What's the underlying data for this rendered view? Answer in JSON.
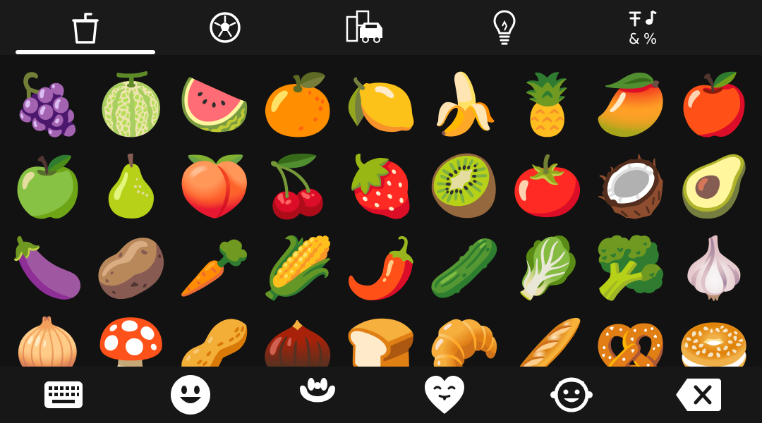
{
  "top_tabs": [
    {
      "name": "drinks-tab",
      "icon": "cup-with-straw-icon",
      "selected": true
    },
    {
      "name": "activities-tab",
      "icon": "soccer-ball-icon",
      "selected": false
    },
    {
      "name": "travel-places-tab",
      "icon": "city-car-icon",
      "selected": false
    },
    {
      "name": "objects-tab",
      "icon": "lightbulb-icon",
      "selected": false
    },
    {
      "name": "symbols-tab",
      "icon": "symbols-icon",
      "selected": false
    }
  ],
  "emoji_rows": [
    [
      "🍇",
      "🍈",
      "🍉",
      "🍊",
      "🍋",
      "🍌",
      "🍍",
      "🥭",
      "🍎"
    ],
    [
      "🍏",
      "🍐",
      "🍑",
      "🍒",
      "🍓",
      "🥝",
      "🍅",
      "🥥",
      "🥑"
    ],
    [
      "🍆",
      "🥔",
      "🥕",
      "🌽",
      "🌶️",
      "🥒",
      "🥬",
      "🥦",
      "🧄"
    ],
    [
      "🧅",
      "🍄",
      "🥜",
      "🌰",
      "🍞",
      "🥐",
      "🥖",
      "🥨",
      "🥯"
    ]
  ],
  "bottom_bar": [
    {
      "name": "keyboard-button",
      "icon": "keyboard-icon"
    },
    {
      "name": "emoji-button",
      "icon": "smiley-icon"
    },
    {
      "name": "gesture-button",
      "icon": "hand-icon"
    },
    {
      "name": "heart-emoji-button",
      "icon": "heart-face-icon"
    },
    {
      "name": "memoji-button",
      "icon": "face-icon"
    },
    {
      "name": "backspace-button",
      "icon": "backspace-icon"
    }
  ],
  "colors": {
    "background": "#121212",
    "tab_bar": "#1a1a1a",
    "bottom_bar": "#171717",
    "accent": "#ffffff"
  }
}
